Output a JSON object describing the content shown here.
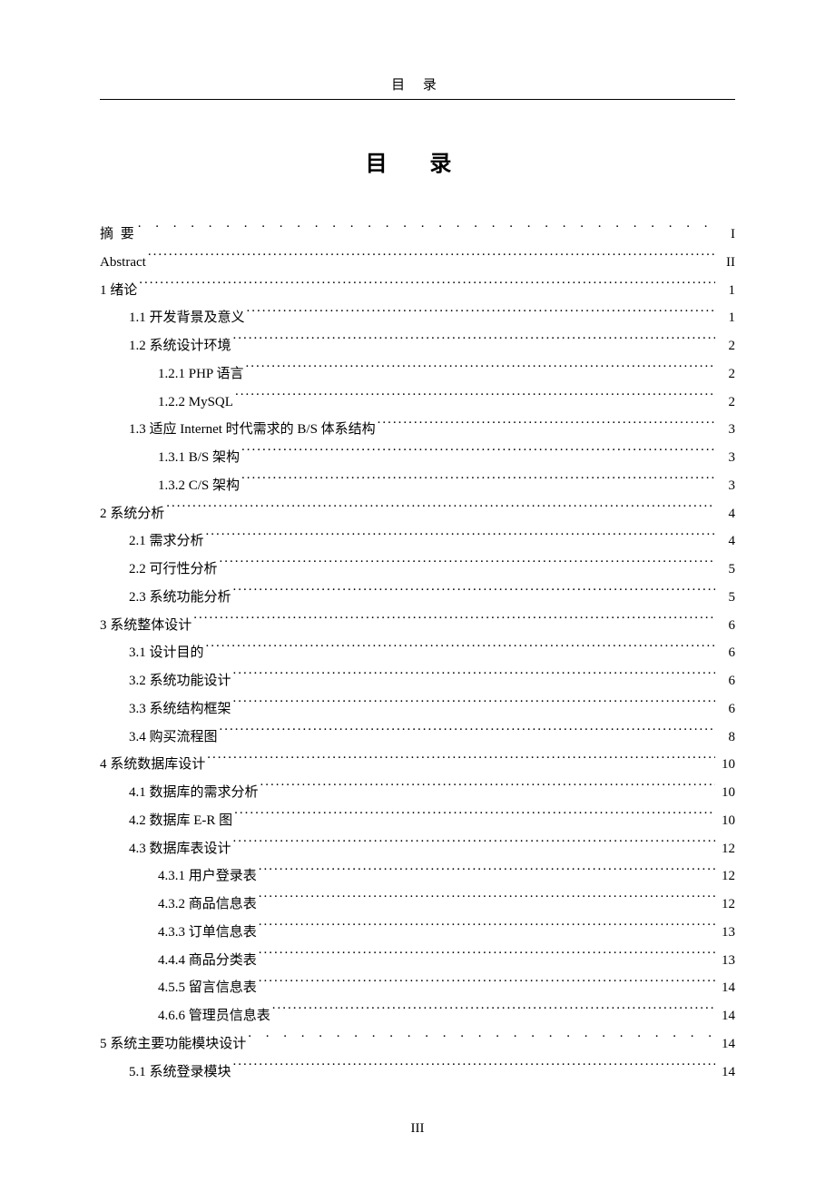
{
  "header": "目 录",
  "title": "目  录",
  "footer_page": "III",
  "toc": [
    {
      "label": "摘 要",
      "page": "I",
      "indent": 0,
      "spaced": true,
      "ls": true
    },
    {
      "label": "Abstract",
      "page": "II",
      "indent": 0
    },
    {
      "label": "1 绪论",
      "page": "1",
      "indent": 0
    },
    {
      "label": "1.1  开发背景及意义",
      "page": "1",
      "indent": 1
    },
    {
      "label": "1.2  系统设计环境",
      "page": "2",
      "indent": 1
    },
    {
      "label": "1.2.1 PHP 语言",
      "page": "2",
      "indent": 2
    },
    {
      "label": "1.2.2 MySQL",
      "page": "2",
      "indent": 2
    },
    {
      "label": "1.3  适应 Internet 时代需求的 B/S 体系结构",
      "page": "3",
      "indent": 1
    },
    {
      "label": "1.3.1 B/S 架构",
      "page": "3",
      "indent": 2
    },
    {
      "label": "1.3.2 C/S 架构",
      "page": "3",
      "indent": 2
    },
    {
      "label": "2 系统分析",
      "page": "4",
      "indent": 0
    },
    {
      "label": "2.1  需求分析",
      "page": "4",
      "indent": 1
    },
    {
      "label": "2.2  可行性分析",
      "page": "5",
      "indent": 1
    },
    {
      "label": "2.3  系统功能分析",
      "page": "5",
      "indent": 1
    },
    {
      "label": "3 系统整体设计",
      "page": "6",
      "indent": 0
    },
    {
      "label": "3.1  设计目的",
      "page": "6",
      "indent": 1
    },
    {
      "label": "3.2  系统功能设计",
      "page": "6",
      "indent": 1
    },
    {
      "label": "3.3  系统结构框架",
      "page": "6",
      "indent": 1
    },
    {
      "label": "3.4  购买流程图",
      "page": "8",
      "indent": 1
    },
    {
      "label": "4 系统数据库设计",
      "page": "10",
      "indent": 0
    },
    {
      "label": "4.1  数据库的需求分析",
      "page": "10",
      "indent": 1
    },
    {
      "label": "4.2  数据库 E-R 图",
      "page": "10",
      "indent": 1
    },
    {
      "label": "4.3  数据库表设计",
      "page": "12",
      "indent": 1
    },
    {
      "label": "4.3.1  用户登录表",
      "page": "12",
      "indent": 2
    },
    {
      "label": "4.3.2  商品信息表",
      "page": "12",
      "indent": 2
    },
    {
      "label": "4.3.3  订单信息表",
      "page": "13",
      "indent": 2
    },
    {
      "label": "4.4.4  商品分类表",
      "page": "13",
      "indent": 2
    },
    {
      "label": "4.5.5  留言信息表",
      "page": "14",
      "indent": 2
    },
    {
      "label": "4.6.6  管理员信息表",
      "page": "14",
      "indent": 2
    },
    {
      "label": "5 系统主要功能模块设计",
      "page": "14",
      "indent": 0,
      "spaced": true
    },
    {
      "label": "5.1  系统登录模块",
      "page": "14",
      "indent": 1
    }
  ]
}
